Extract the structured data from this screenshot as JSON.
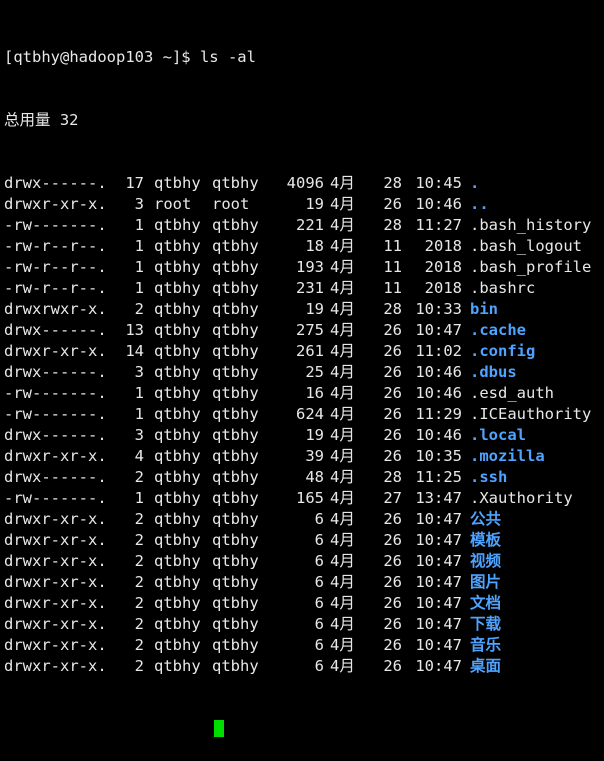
{
  "terminal": {
    "prompt": "[qtbhy@hadoop103 ~]$ ",
    "command": "ls -al",
    "total": "总用量 32",
    "entries": [
      {
        "perms": "drwx------.",
        "links": "17",
        "owner": "qtbhy",
        "group": "qtbhy",
        "size": "4096",
        "month": "4月",
        "day": "28",
        "time": "10:45",
        "name": ".",
        "dir": true
      },
      {
        "perms": "drwxr-xr-x.",
        "links": "3",
        "owner": "root",
        "group": "root",
        "size": "19",
        "month": "4月",
        "day": "26",
        "time": "10:46",
        "name": "..",
        "dir": true
      },
      {
        "perms": "-rw-------.",
        "links": "1",
        "owner": "qtbhy",
        "group": "qtbhy",
        "size": "221",
        "month": "4月",
        "day": "28",
        "time": "11:27",
        "name": ".bash_history",
        "dir": false
      },
      {
        "perms": "-rw-r--r--.",
        "links": "1",
        "owner": "qtbhy",
        "group": "qtbhy",
        "size": "18",
        "month": "4月",
        "day": "11",
        "time": "2018",
        "name": ".bash_logout",
        "dir": false
      },
      {
        "perms": "-rw-r--r--.",
        "links": "1",
        "owner": "qtbhy",
        "group": "qtbhy",
        "size": "193",
        "month": "4月",
        "day": "11",
        "time": "2018",
        "name": ".bash_profile",
        "dir": false
      },
      {
        "perms": "-rw-r--r--.",
        "links": "1",
        "owner": "qtbhy",
        "group": "qtbhy",
        "size": "231",
        "month": "4月",
        "day": "11",
        "time": "2018",
        "name": ".bashrc",
        "dir": false
      },
      {
        "perms": "drwxrwxr-x.",
        "links": "2",
        "owner": "qtbhy",
        "group": "qtbhy",
        "size": "19",
        "month": "4月",
        "day": "28",
        "time": "10:33",
        "name": "bin",
        "dir": true
      },
      {
        "perms": "drwx------.",
        "links": "13",
        "owner": "qtbhy",
        "group": "qtbhy",
        "size": "275",
        "month": "4月",
        "day": "26",
        "time": "10:47",
        "name": ".cache",
        "dir": true
      },
      {
        "perms": "drwxr-xr-x.",
        "links": "14",
        "owner": "qtbhy",
        "group": "qtbhy",
        "size": "261",
        "month": "4月",
        "day": "26",
        "time": "11:02",
        "name": ".config",
        "dir": true
      },
      {
        "perms": "drwx------.",
        "links": "3",
        "owner": "qtbhy",
        "group": "qtbhy",
        "size": "25",
        "month": "4月",
        "day": "26",
        "time": "10:46",
        "name": ".dbus",
        "dir": true
      },
      {
        "perms": "-rw-------.",
        "links": "1",
        "owner": "qtbhy",
        "group": "qtbhy",
        "size": "16",
        "month": "4月",
        "day": "26",
        "time": "10:46",
        "name": ".esd_auth",
        "dir": false
      },
      {
        "perms": "-rw-------.",
        "links": "1",
        "owner": "qtbhy",
        "group": "qtbhy",
        "size": "624",
        "month": "4月",
        "day": "26",
        "time": "11:29",
        "name": ".ICEauthority",
        "dir": false
      },
      {
        "perms": "drwx------.",
        "links": "3",
        "owner": "qtbhy",
        "group": "qtbhy",
        "size": "19",
        "month": "4月",
        "day": "26",
        "time": "10:46",
        "name": ".local",
        "dir": true
      },
      {
        "perms": "drwxr-xr-x.",
        "links": "4",
        "owner": "qtbhy",
        "group": "qtbhy",
        "size": "39",
        "month": "4月",
        "day": "26",
        "time": "10:35",
        "name": ".mozilla",
        "dir": true
      },
      {
        "perms": "drwx------.",
        "links": "2",
        "owner": "qtbhy",
        "group": "qtbhy",
        "size": "48",
        "month": "4月",
        "day": "28",
        "time": "11:25",
        "name": ".ssh",
        "dir": true
      },
      {
        "perms": "-rw-------.",
        "links": "1",
        "owner": "qtbhy",
        "group": "qtbhy",
        "size": "165",
        "month": "4月",
        "day": "27",
        "time": "13:47",
        "name": ".Xauthority",
        "dir": false
      },
      {
        "perms": "drwxr-xr-x.",
        "links": "2",
        "owner": "qtbhy",
        "group": "qtbhy",
        "size": "6",
        "month": "4月",
        "day": "26",
        "time": "10:47",
        "name": "公共",
        "dir": true
      },
      {
        "perms": "drwxr-xr-x.",
        "links": "2",
        "owner": "qtbhy",
        "group": "qtbhy",
        "size": "6",
        "month": "4月",
        "day": "26",
        "time": "10:47",
        "name": "模板",
        "dir": true
      },
      {
        "perms": "drwxr-xr-x.",
        "links": "2",
        "owner": "qtbhy",
        "group": "qtbhy",
        "size": "6",
        "month": "4月",
        "day": "26",
        "time": "10:47",
        "name": "视频",
        "dir": true
      },
      {
        "perms": "drwxr-xr-x.",
        "links": "2",
        "owner": "qtbhy",
        "group": "qtbhy",
        "size": "6",
        "month": "4月",
        "day": "26",
        "time": "10:47",
        "name": "图片",
        "dir": true
      },
      {
        "perms": "drwxr-xr-x.",
        "links": "2",
        "owner": "qtbhy",
        "group": "qtbhy",
        "size": "6",
        "month": "4月",
        "day": "26",
        "time": "10:47",
        "name": "文档",
        "dir": true
      },
      {
        "perms": "drwxr-xr-x.",
        "links": "2",
        "owner": "qtbhy",
        "group": "qtbhy",
        "size": "6",
        "month": "4月",
        "day": "26",
        "time": "10:47",
        "name": "下载",
        "dir": true
      },
      {
        "perms": "drwxr-xr-x.",
        "links": "2",
        "owner": "qtbhy",
        "group": "qtbhy",
        "size": "6",
        "month": "4月",
        "day": "26",
        "time": "10:47",
        "name": "音乐",
        "dir": true
      },
      {
        "perms": "drwxr-xr-x.",
        "links": "2",
        "owner": "qtbhy",
        "group": "qtbhy",
        "size": "6",
        "month": "4月",
        "day": "26",
        "time": "10:47",
        "name": "桌面",
        "dir": true
      }
    ],
    "colors": {
      "background": "#000000",
      "text": "#e8e8e8",
      "directory": "#4fa3ff",
      "cursor": "#00dd00"
    }
  }
}
